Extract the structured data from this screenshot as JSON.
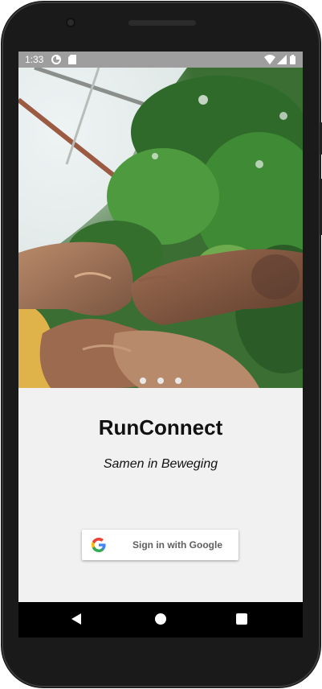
{
  "status_bar": {
    "time": "1:33",
    "icons": [
      "data-saver-icon",
      "sd-card-icon",
      "wifi-icon",
      "signal-icon",
      "battery-icon"
    ]
  },
  "hero": {
    "image": "fist-bump-photo",
    "carousel_dots": 3
  },
  "app": {
    "title": "RunConnect",
    "tagline": "Samen in Beweging"
  },
  "sign_in": {
    "label": "Sign in with Google",
    "icon": "google-logo-icon"
  },
  "nav_bar": {
    "buttons": [
      "back-icon",
      "home-icon",
      "recents-icon"
    ]
  },
  "colors": {
    "status_bar": "#9e9e9e",
    "screen_bg": "#f1f1f1",
    "nav_bar": "#000000",
    "button_bg": "#ffffff",
    "google_blue": "#4285F4",
    "google_red": "#EA4335",
    "google_yellow": "#FBBC05",
    "google_green": "#34A853"
  }
}
